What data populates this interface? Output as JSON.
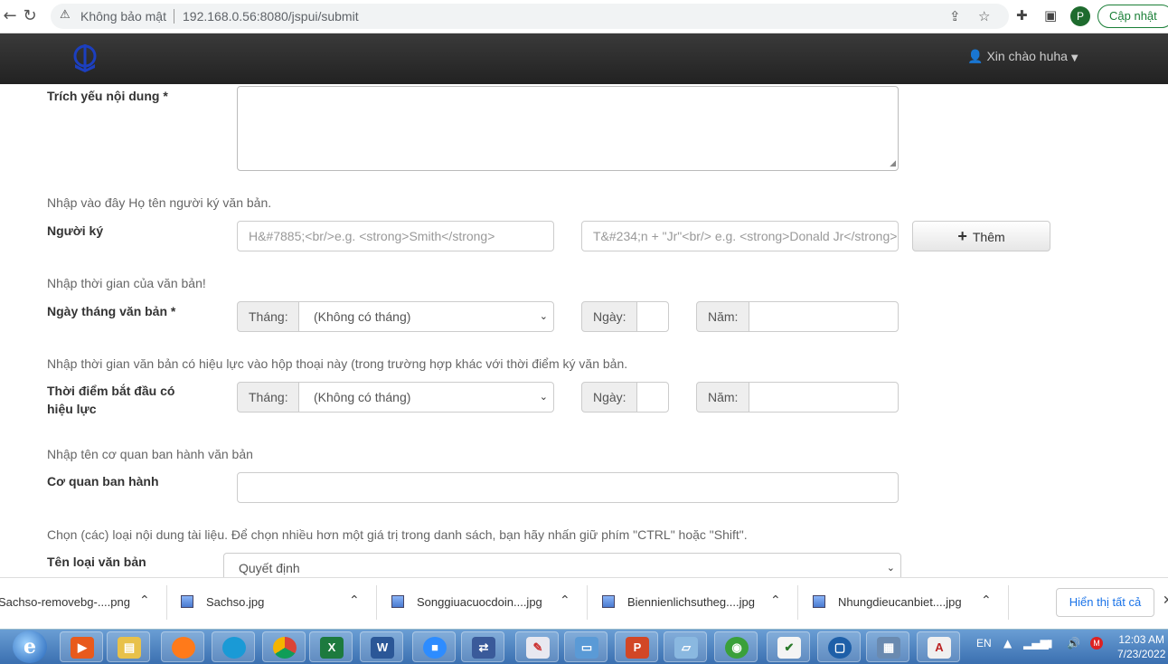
{
  "browser": {
    "security_label": "Không bảo mật",
    "url": "192.168.0.56:8080/jspui/submit",
    "profile_initial": "P",
    "update_label": "Cập nhật"
  },
  "header": {
    "user_greeting": "Xin chào huha"
  },
  "form": {
    "summary": {
      "label": "Trích yếu nội dung *"
    },
    "signer": {
      "hint": "Nhập vào đây Họ tên người ký văn bản.",
      "label": "Người ký",
      "last_name_placeholder": "H&#7885;<br/>e.g. <strong>Smith</strong>",
      "first_name_placeholder": "T&#234;n + \"Jr\"<br/> e.g. <strong>Donald Jr</strong>",
      "add_label": "Thêm"
    },
    "doc_date": {
      "hint": "Nhập thời gian của văn bản!",
      "label": "Ngày tháng văn bản *",
      "month_label": "Tháng:",
      "month_value": "(Không có tháng)",
      "day_label": "Ngày:",
      "year_label": "Năm:"
    },
    "effective_date": {
      "hint": "Nhập thời gian văn bản có hiệu lực vào hộp thoại này (trong trường hợp khác với thời điểm ký văn bản.",
      "label_line1": "Thời điểm bắt đầu có",
      "label_line2": "hiệu lực",
      "month_label": "Tháng:",
      "month_value": "(Không có tháng)",
      "day_label": "Ngày:",
      "year_label": "Năm:"
    },
    "agency": {
      "hint": "Nhập tên cơ quan ban hành văn bản",
      "label": "Cơ quan ban hành"
    },
    "doc_type": {
      "hint": "Chọn (các) loại nội dung tài liệu. Để chọn nhiều hơn một giá trị trong danh sách, bạn hãy nhấn giữ phím \"CTRL\" hoặc \"Shift\".",
      "label": "Tên loại văn bản",
      "value": "Quyết định"
    }
  },
  "downloads": {
    "items": [
      "Sachso-removebg-....png",
      "Sachso.jpg",
      "Songgiuacuocdoin....jpg",
      "Biennienlichsutheg....jpg",
      "Nhungdieucanbiet....jpg"
    ],
    "show_all_label": "Hiển thị tất cả"
  },
  "taskbar": {
    "language": "EN",
    "time": "12:03 AM",
    "date": "7/23/2022"
  },
  "icons": {
    "back": "back-arrow-icon",
    "reload": "reload-icon",
    "warning": "warning-icon",
    "share": "share-icon",
    "star": "star-icon",
    "extensions": "puzzle-icon",
    "sidepanel": "side-panel-icon",
    "user": "user-icon",
    "plus": "plus-icon",
    "caret": "chevron-down-icon"
  }
}
